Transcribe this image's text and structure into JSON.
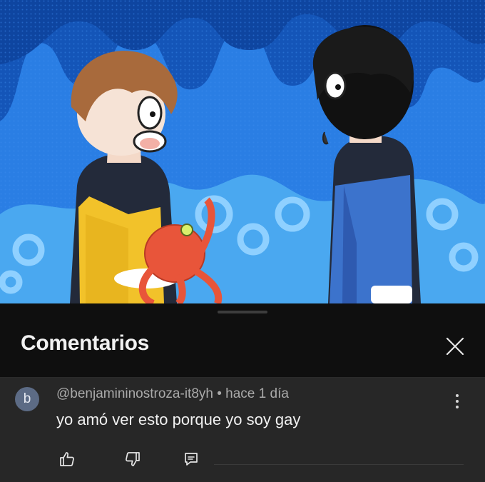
{
  "colors": {
    "panel_background": "#0f0f0f",
    "comment_background": "#272727",
    "title_text": "#f1f1f1",
    "meta_text": "#aaaaaa",
    "video_water": "#1e6fd6"
  },
  "video": {
    "description_icons": [
      "video-frame"
    ]
  },
  "comments_panel": {
    "title": "Comentarios",
    "close_icon": "close-icon"
  },
  "comment": {
    "avatar_letter": "b",
    "author": "@benjamininostroza-it8yh",
    "separator": " • ",
    "time": "hace 1 día",
    "text": "yo amó ver esto porque yo soy gay",
    "icons": {
      "like": "thumbs-up-icon",
      "dislike": "thumbs-down-icon",
      "reply": "reply-icon",
      "menu": "more-vert-icon"
    }
  }
}
